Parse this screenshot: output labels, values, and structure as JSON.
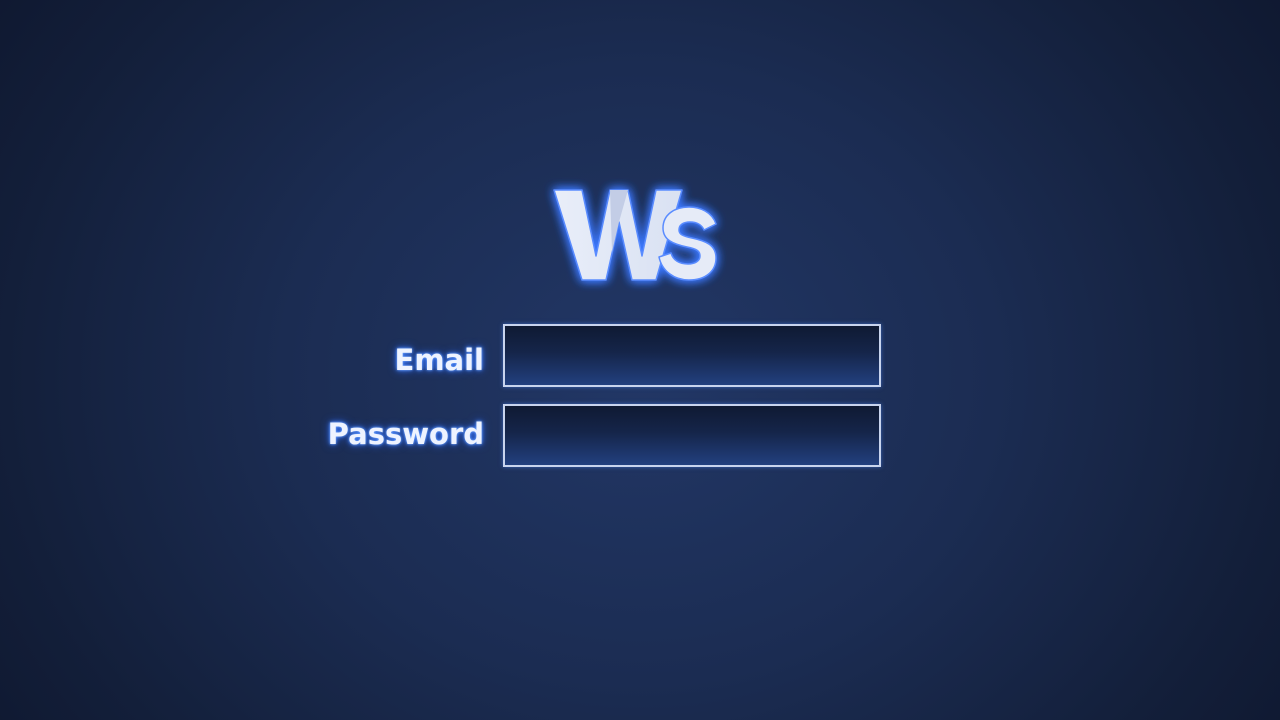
{
  "logo": {
    "text": "Ws",
    "fill_color": "#e6ebf7",
    "glow_color": "#3c78ff"
  },
  "form": {
    "email": {
      "label": "Email",
      "value": "",
      "placeholder": ""
    },
    "password": {
      "label": "Password",
      "value": "",
      "placeholder": ""
    }
  },
  "colors": {
    "background": "#1e3160",
    "label_text": "#eef3ff",
    "label_glow": "#3d7dff",
    "input_border": "#c8d4ee"
  }
}
